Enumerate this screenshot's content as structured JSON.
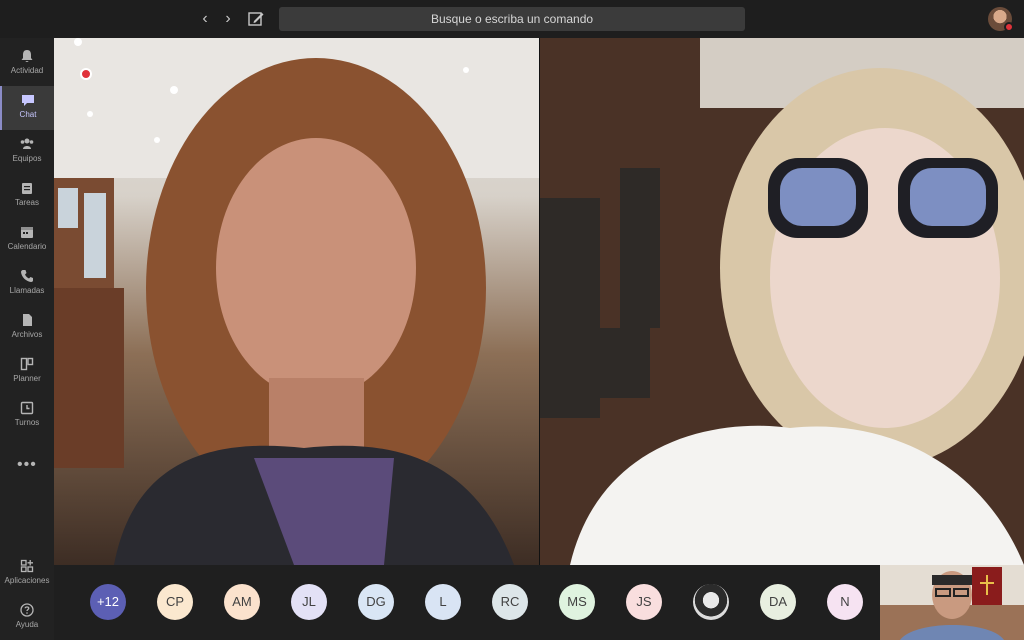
{
  "search": {
    "placeholder": "Busque o escriba un comando"
  },
  "rail": {
    "items": [
      {
        "label": "Actividad"
      },
      {
        "label": "Chat"
      },
      {
        "label": "Equipos"
      },
      {
        "label": "Tareas"
      },
      {
        "label": "Calendario"
      },
      {
        "label": "Llamadas"
      },
      {
        "label": "Archivos"
      },
      {
        "label": "Planner"
      },
      {
        "label": "Turnos"
      }
    ],
    "more": "•••",
    "bottom": [
      {
        "label": "Aplicaciones"
      },
      {
        "label": "Ayuda"
      }
    ]
  },
  "participants": [
    {
      "initials": "+12",
      "color": "#5c5fb4"
    },
    {
      "initials": "CP",
      "color": "#fbe8cf"
    },
    {
      "initials": "AM",
      "color": "#fbe2cd"
    },
    {
      "initials": "JL",
      "color": "#e3e1f6"
    },
    {
      "initials": "DG",
      "color": "#d9e6f5"
    },
    {
      "initials": "L",
      "color": "#d9e4f4"
    },
    {
      "initials": "RC",
      "color": "#dde6e9"
    },
    {
      "initials": "MS",
      "color": "#dff3df"
    },
    {
      "initials": "JS",
      "color": "#f9dede"
    },
    {
      "initials": "",
      "color": "#ededed"
    },
    {
      "initials": "DA",
      "color": "#e8efe0"
    },
    {
      "initials": "N",
      "color": "#f6e3f2"
    }
  ],
  "colors": {
    "accent": "#8b8cc7",
    "recording": "#e0323a"
  }
}
